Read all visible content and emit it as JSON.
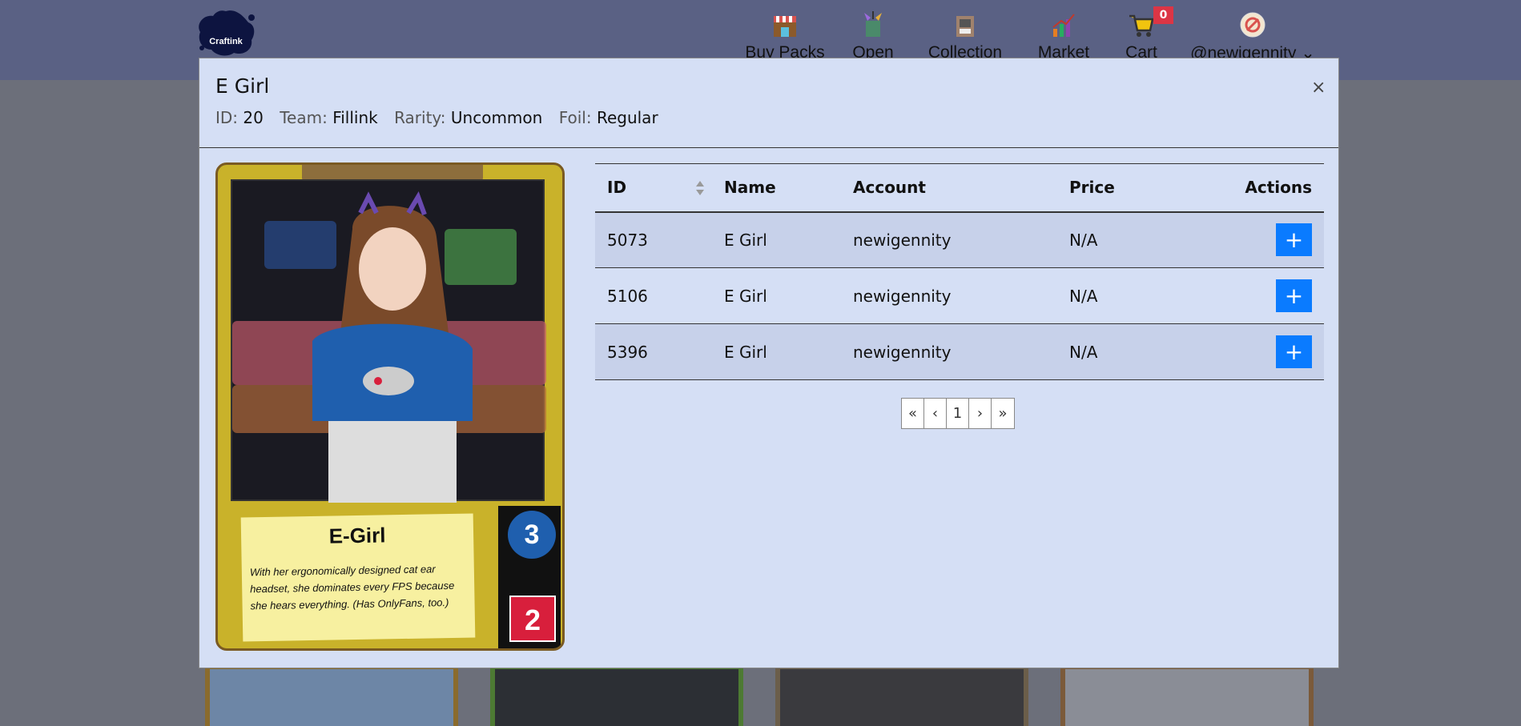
{
  "nav": {
    "logo_text": "Craftink",
    "items": [
      {
        "label": "Buy Packs",
        "icon": "shop-icon"
      },
      {
        "label": "Open",
        "icon": "open-pack-icon"
      },
      {
        "label": "Collection",
        "icon": "collection-icon"
      },
      {
        "label": "Market",
        "icon": "market-chart-icon"
      },
      {
        "label": "Cart",
        "icon": "cart-icon"
      }
    ],
    "cart_count": "0",
    "user": "@newigennity"
  },
  "modal": {
    "title": "E Girl",
    "close_label": "×",
    "meta": {
      "id_label": "ID:",
      "id_value": "20",
      "team_label": "Team:",
      "team_value": "Fillink",
      "rarity_label": "Rarity:",
      "rarity_value": "Uncommon",
      "foil_label": "Foil:",
      "foil_value": "Regular"
    }
  },
  "card": {
    "name": "E-Girl",
    "flavor": "With her ergonomically designed cat ear headset, she dominates every FPS because she hears everything. (Has OnlyFans, too.)",
    "cost": "3",
    "power": "2"
  },
  "table": {
    "headers": {
      "id": "ID",
      "name": "Name",
      "account": "Account",
      "price": "Price",
      "actions": "Actions"
    },
    "rows": [
      {
        "id": "5073",
        "name": "E Girl",
        "account": "newigennity",
        "price": "N/A",
        "action": "+"
      },
      {
        "id": "5106",
        "name": "E Girl",
        "account": "newigennity",
        "price": "N/A",
        "action": "+"
      },
      {
        "id": "5396",
        "name": "E Girl",
        "account": "newigennity",
        "price": "N/A",
        "action": "+"
      }
    ]
  },
  "pagination": {
    "first": "«",
    "prev": "‹",
    "current": "1",
    "next": "›",
    "last": "»"
  }
}
